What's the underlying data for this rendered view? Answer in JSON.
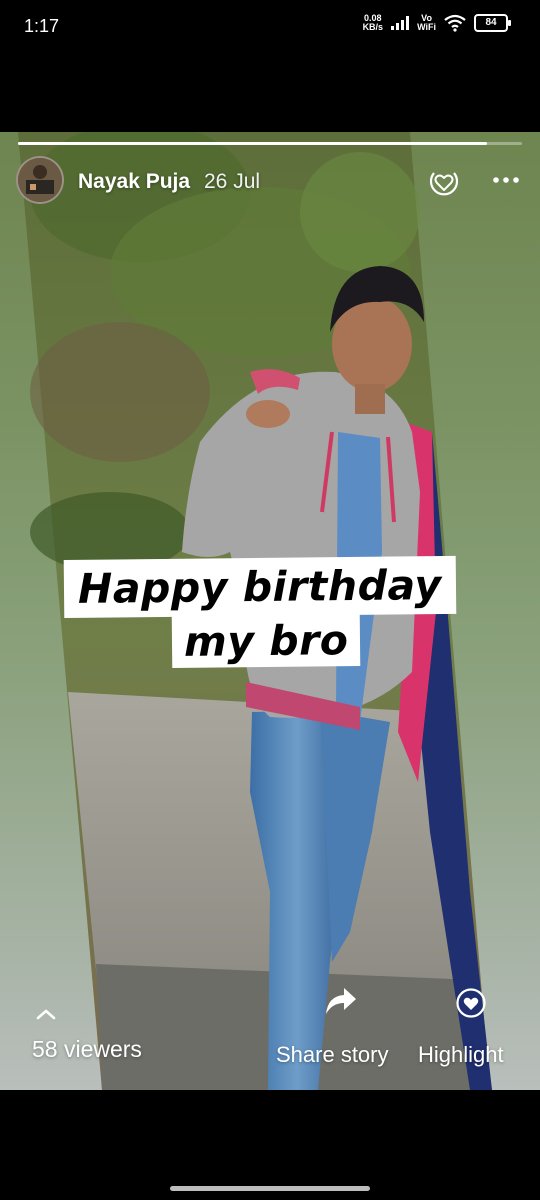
{
  "status_bar": {
    "time": "1:17",
    "net_speed_value": "0.08",
    "net_speed_unit": "KB/s",
    "volte_top": "Vo",
    "volte_bottom": "WiFi",
    "battery": "84"
  },
  "story": {
    "progress_fraction": 0.93,
    "user_name": "Nayak Puja",
    "date": "26 Jul",
    "caption_line1": "Happy birthday",
    "caption_line2": "my bro",
    "viewers_label": "58 viewers",
    "share_label": "Share story",
    "highlight_label": "Highlight"
  },
  "icons": {
    "avatar": "profile-avatar",
    "heart": "heart-circle-icon",
    "more": "more-dots-icon",
    "chevron": "chevron-up-icon",
    "share": "share-arrow-icon",
    "highlight": "highlight-heart-circle-icon"
  },
  "colors": {
    "background": "#000000",
    "caption_bg": "#ffffff",
    "caption_text": "#000000",
    "overlay_text": "#ffffff"
  }
}
